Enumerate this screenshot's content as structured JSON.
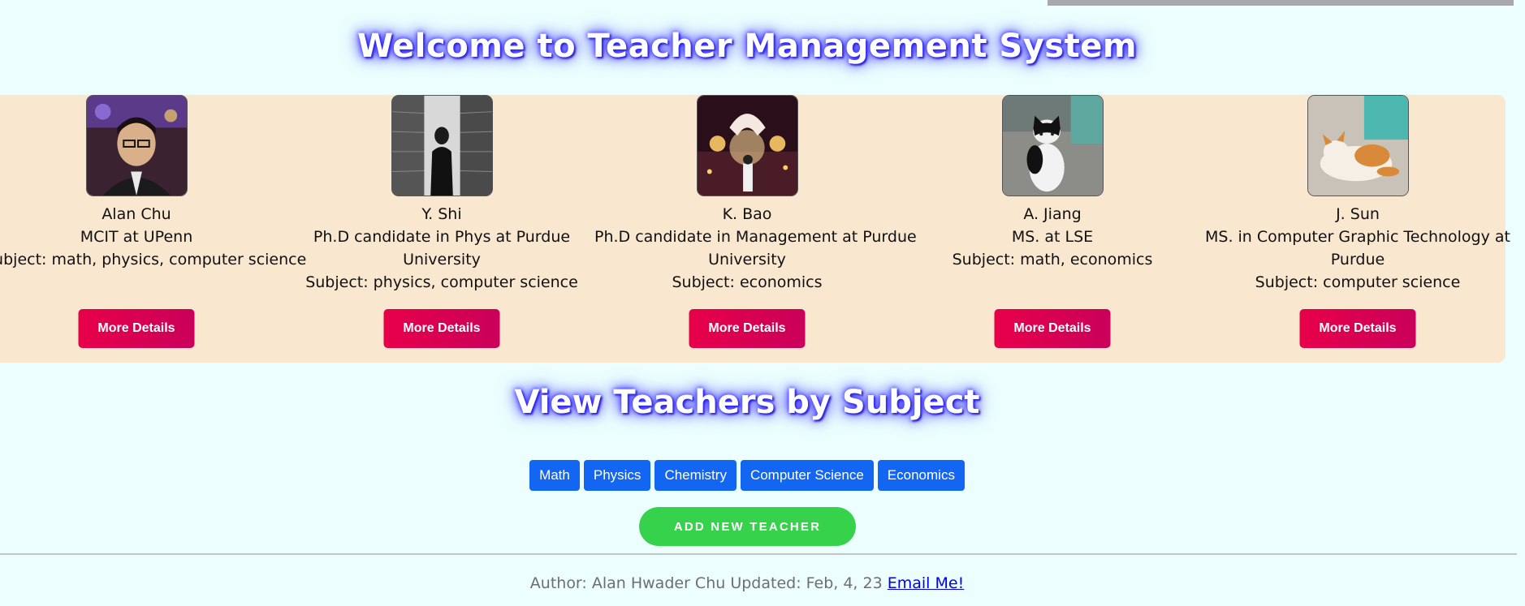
{
  "page": {
    "title": "Welcome to Teacher Management System"
  },
  "teachers": [
    {
      "name": "Alan Chu",
      "degree_lines": [
        "MCIT at UPenn"
      ],
      "subject": "Subject: math, physics, computer science",
      "button": "More Details",
      "photo_icon": "portrait-photo"
    },
    {
      "name": "Y. Shi",
      "degree_lines": [
        "Ph.D candidate in Phys at Purdue",
        "University"
      ],
      "subject": "Subject: physics, computer science",
      "button": "More Details",
      "photo_icon": "library-photo"
    },
    {
      "name": "K. Bao",
      "degree_lines": [
        "Ph.D candidate in Management at Purdue",
        "University"
      ],
      "subject": "Subject: economics",
      "button": "More Details",
      "photo_icon": "carousel-photo"
    },
    {
      "name": "A. Jiang",
      "degree_lines": [
        "MS. at LSE"
      ],
      "subject": "Subject: math, economics",
      "button": "More Details",
      "photo_icon": "cat-photo"
    },
    {
      "name": "J. Sun",
      "degree_lines": [
        "MS. in Computer Graphic Technology at",
        "Purdue"
      ],
      "subject": "Subject: computer science",
      "button": "More Details",
      "photo_icon": "cat-lying-photo"
    }
  ],
  "subjects": {
    "title": "View Teachers by Subject",
    "buttons": [
      "Math",
      "Physics",
      "Chemistry",
      "Computer Science",
      "Economics"
    ]
  },
  "add_teacher": {
    "label": "ADD NEW TEACHER"
  },
  "footer": {
    "text": "Author: Alan Hwader Chu Updated: Feb, 4, 23",
    "link_label": "Email Me!"
  },
  "colors": {
    "background": "#ecfffe",
    "card_strip": "#f9e7cf",
    "details_button": "#e0004f",
    "subject_button": "#1266f1",
    "add_button": "#37d24c",
    "title_glow": "#3a30ff"
  }
}
